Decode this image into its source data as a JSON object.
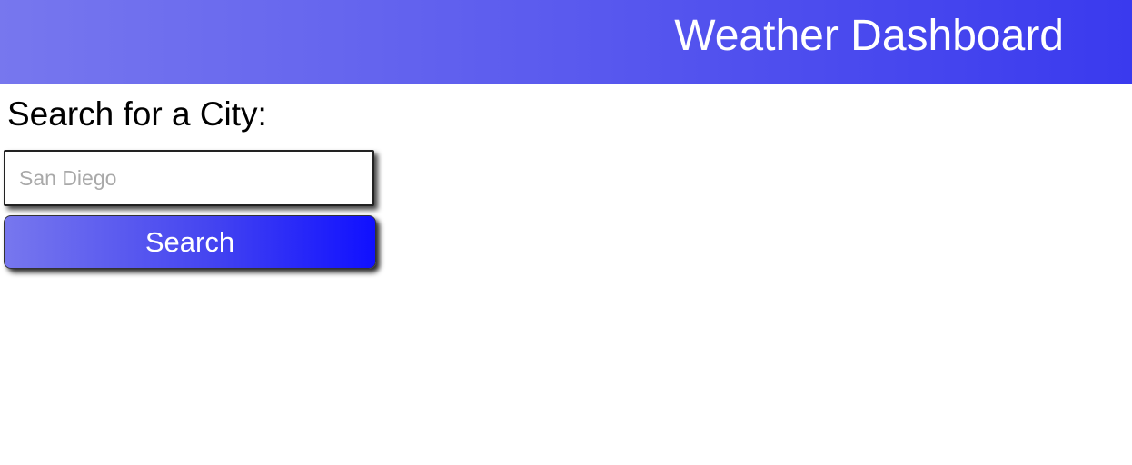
{
  "header": {
    "title": "Weather Dashboard"
  },
  "search": {
    "heading": "Search for a City:",
    "input_placeholder": "San Diego",
    "input_value": "",
    "button_label": "Search"
  },
  "colors": {
    "header_gradient_start": "#7777ee",
    "header_gradient_end": "#3a3aee",
    "button_gradient_start": "#7777ee",
    "button_gradient_end": "#1010ff",
    "text_light": "#ffffff"
  }
}
